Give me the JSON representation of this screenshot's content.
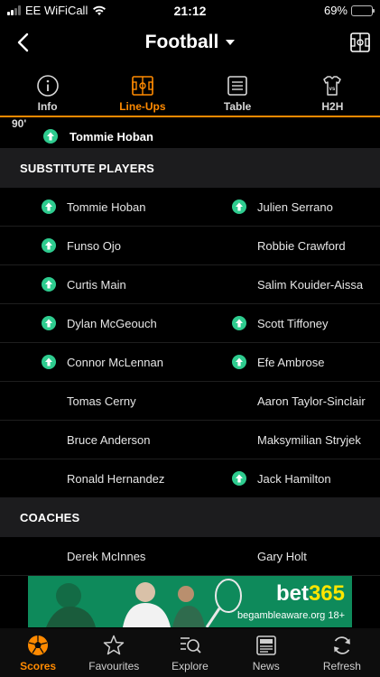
{
  "status_bar": {
    "carrier": "EE WiFiCall",
    "time": "21:12",
    "battery": "69%",
    "battery_level": 0.69
  },
  "header": {
    "title": "Football",
    "back_icon": "chevron-left-icon",
    "pitch_icon": "pitch-icon"
  },
  "tabs": [
    {
      "label": "Info",
      "icon": "info-icon",
      "active": false
    },
    {
      "label": "Line-Ups",
      "icon": "pitch-icon",
      "active": true
    },
    {
      "label": "Table",
      "icon": "table-icon",
      "active": false
    },
    {
      "label": "H2H",
      "icon": "shirt-icon",
      "active": false
    }
  ],
  "top_event": {
    "minute": "90'",
    "player": "Tommie Hoban"
  },
  "substitutes": {
    "header": "SUBSTITUTE PLAYERS",
    "rows": [
      {
        "home": "Tommie Hoban",
        "home_sub": true,
        "away": "Julien Serrano",
        "away_sub": true
      },
      {
        "home": "Funso Ojo",
        "home_sub": true,
        "away": "Robbie Crawford",
        "away_sub": false
      },
      {
        "home": "Curtis Main",
        "home_sub": true,
        "away": "Salim Kouider-Aissa",
        "away_sub": false
      },
      {
        "home": "Dylan McGeouch",
        "home_sub": true,
        "away": "Scott Tiffoney",
        "away_sub": true
      },
      {
        "home": "Connor McLennan",
        "home_sub": true,
        "away": "Efe Ambrose",
        "away_sub": true
      },
      {
        "home": "Tomas Cerny",
        "home_sub": false,
        "away": "Aaron Taylor-Sinclair",
        "away_sub": false
      },
      {
        "home": "Bruce Anderson",
        "home_sub": false,
        "away": "Maksymilian Stryjek",
        "away_sub": false
      },
      {
        "home": "Ronald Hernandez",
        "home_sub": false,
        "away": "Jack Hamilton",
        "away_sub": true
      }
    ]
  },
  "coaches": {
    "header": "COACHES",
    "home": "Derek McInnes",
    "away": "Gary Holt"
  },
  "ad": {
    "brand_prefix": "bet",
    "brand_suffix": "365",
    "tagline": "begambleaware.org  18+"
  },
  "bottom_nav": [
    {
      "label": "Scores",
      "icon": "football-icon",
      "active": true
    },
    {
      "label": "Favourites",
      "icon": "star-icon",
      "active": false
    },
    {
      "label": "Explore",
      "icon": "search-list-icon",
      "active": false
    },
    {
      "label": "News",
      "icon": "newspaper-icon",
      "active": false
    },
    {
      "label": "Refresh",
      "icon": "refresh-icon",
      "active": false
    }
  ],
  "colors": {
    "accent": "#ff8a00",
    "sub_icon": "#2ecc8f",
    "section_bg": "#1c1c1e",
    "ad_green": "#0e8a5b"
  }
}
